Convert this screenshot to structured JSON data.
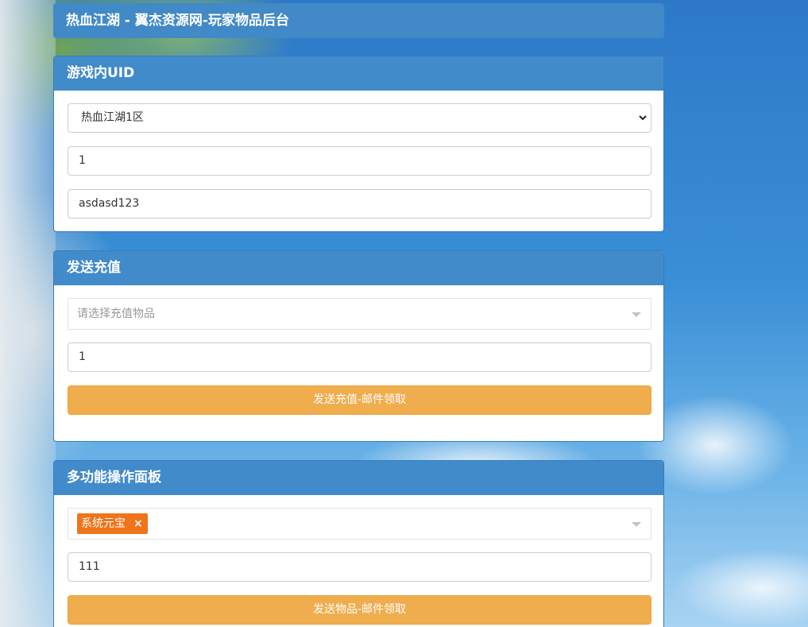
{
  "header": {
    "title": "热血江湖 - 翼杰资源网-玩家物品后台"
  },
  "uid_panel": {
    "title": "游戏内UID",
    "server_select": "热血江湖1区",
    "uid_value": "1",
    "password_value": "asdasd123"
  },
  "recharge_panel": {
    "title": "发送充值",
    "item_placeholder": "请选择充值物品",
    "quantity_value": "1",
    "submit_label": "发送充值-邮件领取"
  },
  "multi_panel": {
    "title": "多功能操作面板",
    "selected_tag": "系统元宝",
    "tag_remove": "×",
    "quantity_value": "111",
    "submit_label": "发送物品-邮件领取"
  },
  "colors": {
    "panel_header": "#428bca",
    "button": "#f0ad4e",
    "tag": "#f0741a"
  },
  "icons": [
    "chevron-down-icon",
    "dropdown-triangle-icon",
    "close-icon"
  ]
}
